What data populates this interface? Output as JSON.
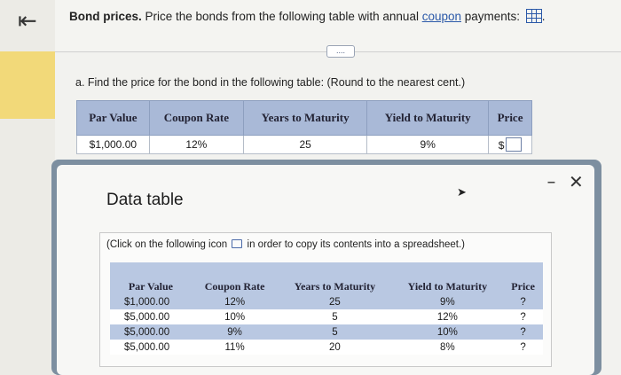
{
  "nav": {
    "back_glyph": "⇤"
  },
  "question": {
    "bold": "Bond prices.",
    "text_pre": " Price the bonds from the following table with annual ",
    "link": "coupon",
    "text_post": " payments:",
    "more": "....",
    "part_a": "a. Find the price for the bond in the following table:  (Round to the nearest cent.)"
  },
  "main_table": {
    "headers": [
      "Par Value",
      "Coupon Rate",
      "Years to Maturity",
      "Yield to Maturity",
      "Price"
    ],
    "row": {
      "par": "$1,000.00",
      "coupon": "12%",
      "years": "25",
      "yield": "9%",
      "price_prefix": "$"
    }
  },
  "dialog": {
    "title": "Data table",
    "minimize": "–",
    "close": "✕",
    "note_pre": "(Click on the following icon ",
    "note_post": " in order to copy its contents into a spreadsheet.)",
    "headers": [
      "Par Value",
      "Coupon Rate",
      "Years to Maturity",
      "Yield to Maturity",
      "Price"
    ],
    "rows": [
      {
        "par": "$1,000.00",
        "coupon": "12%",
        "years": "25",
        "yield": "9%",
        "price": "?"
      },
      {
        "par": "$5,000.00",
        "coupon": "10%",
        "years": "5",
        "yield": "12%",
        "price": "?"
      },
      {
        "par": "$5,000.00",
        "coupon": "9%",
        "years": "5",
        "yield": "10%",
        "price": "?"
      },
      {
        "par": "$5,000.00",
        "coupon": "11%",
        "years": "20",
        "yield": "8%",
        "price": "?"
      }
    ]
  },
  "colors": {
    "link": "#2a58a8",
    "table_header": "#a9b9d7",
    "dialog_frame": "#7d8fa0",
    "highlight": "#f2d979"
  }
}
